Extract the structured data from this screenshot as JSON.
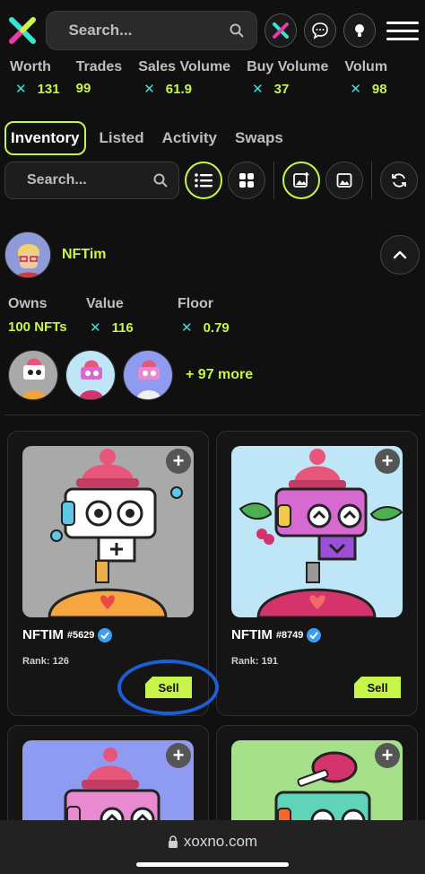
{
  "header": {
    "search_placeholder": "Search..."
  },
  "stats": [
    {
      "label": "Worth",
      "value": "131",
      "currency_icon": true
    },
    {
      "label": "Trades",
      "value": "99",
      "currency_icon": false
    },
    {
      "label": "Sales Volume",
      "value": "61.9",
      "currency_icon": true
    },
    {
      "label": "Buy Volume",
      "value": "37",
      "currency_icon": true
    },
    {
      "label": "Volum",
      "value": "98",
      "currency_icon": true
    }
  ],
  "tabs": [
    "Inventory",
    "Listed",
    "Activity",
    "Swaps"
  ],
  "inventory_search_placeholder": "Search...",
  "user": {
    "name": "NFTim",
    "owns_label": "Owns",
    "owns_value": "100 NFTs",
    "value_label": "Value",
    "value_value": "116",
    "floor_label": "Floor",
    "floor_value": "0.79",
    "more_text": "+ 97 more"
  },
  "cards": [
    {
      "name": "NFTIM",
      "number": "#5629",
      "rank": "Rank: 126",
      "sell": "Sell",
      "bg": "#a9a9a9"
    },
    {
      "name": "NFTIM",
      "number": "#8749",
      "rank": "Rank: 191",
      "sell": "Sell",
      "bg": "#bfe6f7"
    },
    {
      "bg": "#8e9bf0"
    },
    {
      "bg": "#a6e08a"
    }
  ],
  "browser": {
    "url": "xoxno.com"
  },
  "colors": {
    "accent": "#c7f54a",
    "currency": "#33e6d6",
    "background": "#101010"
  }
}
